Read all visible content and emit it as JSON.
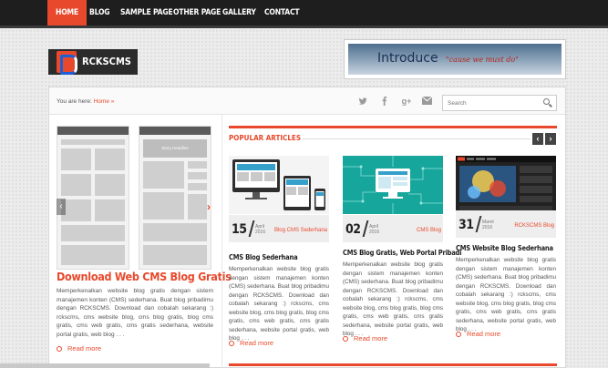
{
  "nav": {
    "items": [
      "HOME",
      "BLOG",
      "SAMPLE PAGE",
      "OTHER PAGE",
      "GALLERY",
      "CONTACT"
    ]
  },
  "logo": {
    "text": "RCKSCMS"
  },
  "banner": {
    "title": "Introduce",
    "tagline": "cause we must do"
  },
  "breadcrumb": {
    "prefix": "You are here:",
    "home": "Home",
    "sep": "»"
  },
  "search": {
    "placeholder": "Search"
  },
  "social": [
    "twitter-icon",
    "facebook-icon",
    "google-plus-icon",
    "mail-icon"
  ],
  "featured": {
    "mock_label": "Story Headline",
    "title": "Download Web CMS Blog Gratis",
    "excerpt": "Memperkenalkan website blog gratis dengan sistem manajemen konten (CMS) sederhana. Buat blog pribadimu dengan RCKSCMS. Download dan cobalah sekarang :) rckscms, cms website blog, cms blog gratis, blog cms gratis, cms web gratis, cms gratis sederhana, website portal gratis, web blog . . .",
    "readmore": "Read more"
  },
  "popular": {
    "heading": "POPULAR ARTICLES",
    "prev": "‹",
    "next": "›",
    "cards": [
      {
        "day": "15",
        "month": "April",
        "year": "2016",
        "category": "Blog CMS Sederhana",
        "title": "CMS Blog Sederhana",
        "excerpt": "Memperkenalkan website blog gratis dengan sistem manajemen konten (CMS) sederhana. Buat blog pribadimu dengan RCKSCMS. Download dan cobalah sekarang :) rckscms, cms website blog, cms blog gratis, blog cms gratis, cms web gratis, cms gratis sederhana, website portal gratis, web blog . . .",
        "readmore": "Read more"
      },
      {
        "day": "02",
        "month": "April",
        "year": "2016",
        "category": "CMS Blog",
        "title": "CMS Blog Gratis, Web Portal Pribadi",
        "excerpt": "Memperkenalkan website blog gratis dengan sistem manajemen konten (CMS) sederhana. Buat blog pribadimu dengan RCKSCMS. Download dan cobalah sekarang :) rckscms, cms website blog, cms blog gratis, blog cms gratis, cms web gratis, cms gratis sederhana, website portal gratis, web blog . . .",
        "readmore": "Read more"
      },
      {
        "day": "31",
        "month": "Maret",
        "year": "2016",
        "category": "RCKSCMS Blog",
        "title": "CMS Website Blog Sederhana",
        "excerpt": "Memperkenalkan website blog gratis dengan sistem manajemen konten (CMS) sederhana. Buat blog pribadimu dengan RCKSCMS. Download dan cobalah sekarang :) rckscms, cms website blog, cms blog gratis, blog cms gratis, cms web gratis, cms gratis sederhana, website portal gratis, web blog . . .",
        "readmore": "Read more"
      }
    ]
  },
  "colors": {
    "accent": "#e8492c",
    "nav_bg": "#1e1e1e"
  }
}
